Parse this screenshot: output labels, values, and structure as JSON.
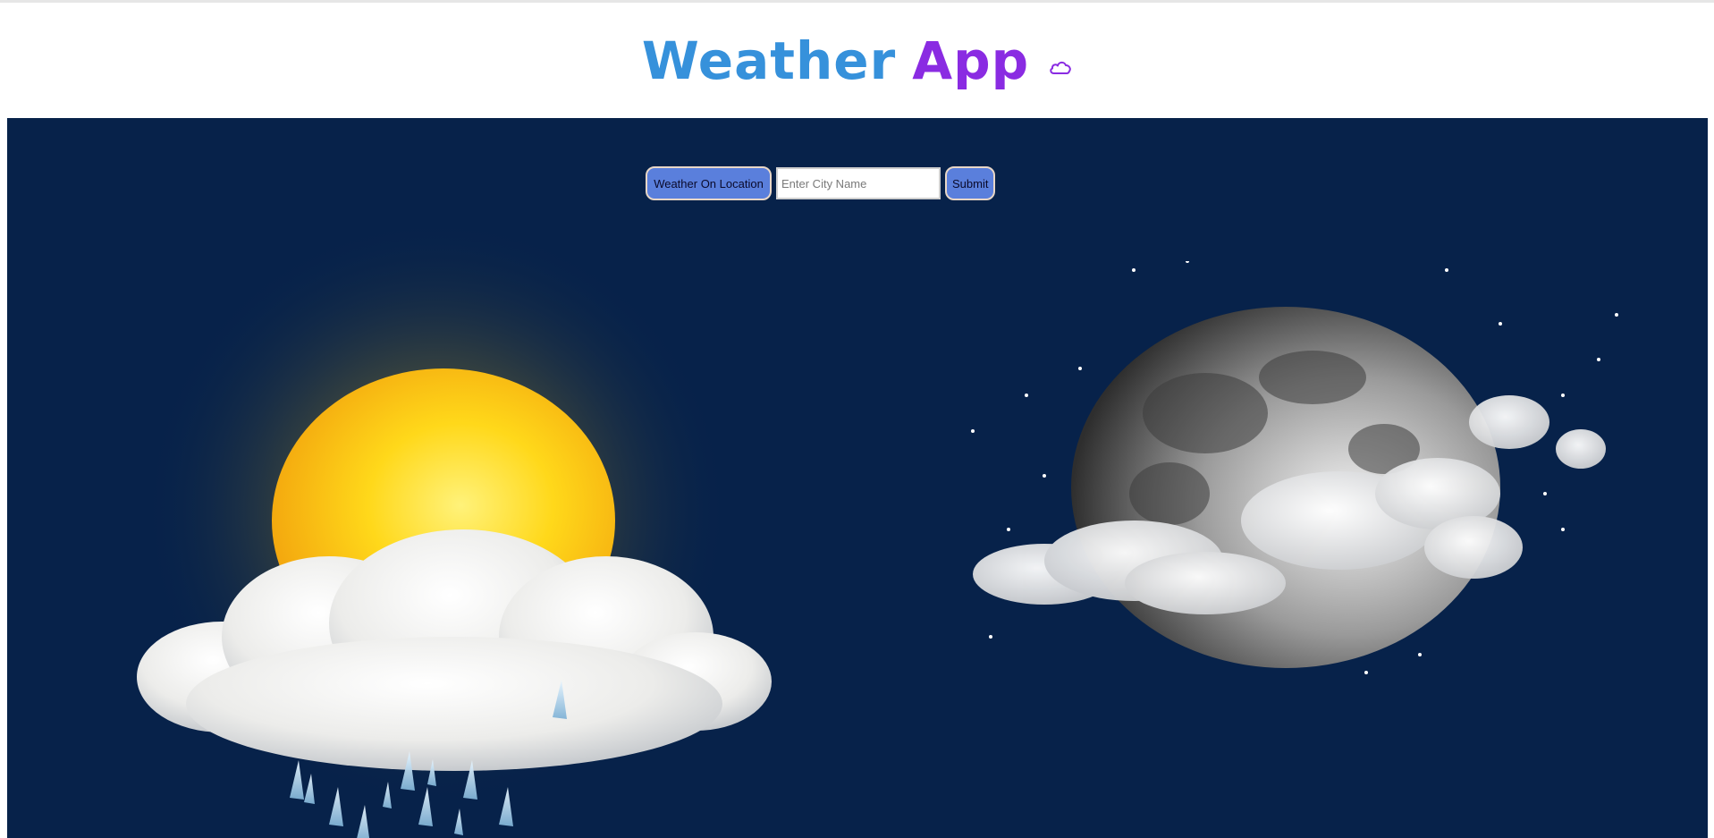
{
  "header": {
    "title_word1": "Weather",
    "title_word2": "App",
    "title_icon": "cloud-icon",
    "colors": {
      "word1": "#3691db",
      "word2": "#8a2be2"
    }
  },
  "controls": {
    "location_button": "Weather On Location",
    "city_input": {
      "value": "",
      "placeholder": "Enter City Name"
    },
    "submit_button": "Submit"
  },
  "scene": {
    "background": "#07224a",
    "left_illustration": "sun-cloud-rain-icon",
    "right_illustration": "moon-clouds-stars-icon"
  }
}
